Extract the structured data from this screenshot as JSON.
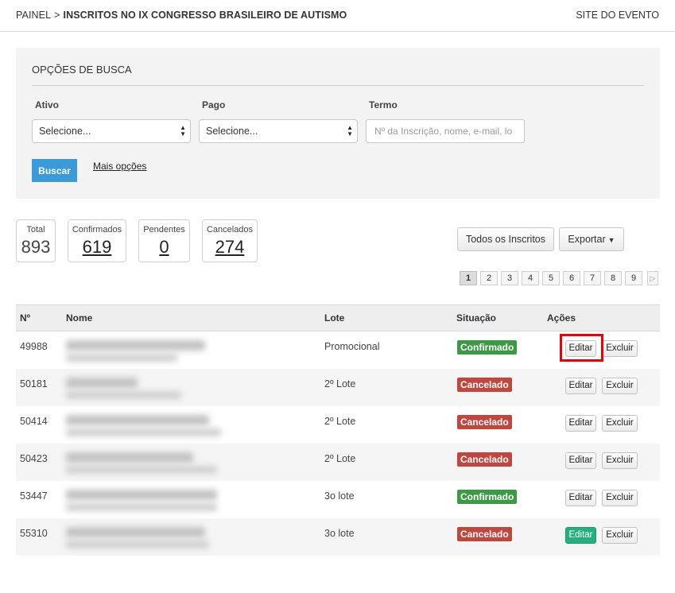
{
  "breadcrumb": {
    "root": "PAINEL",
    "separator": ">",
    "current": "INSCRITOS NO IX CONGRESSO BRASILEIRO DE AUTISMO"
  },
  "site_link": "SITE DO EVENTO",
  "search": {
    "title": "OPÇÕES DE BUSCA",
    "ativo_label": "Ativo",
    "ativo_value": "Selecione...",
    "pago_label": "Pago",
    "pago_value": "Selecione...",
    "termo_label": "Termo",
    "termo_placeholder": "Nº da Inscrição, nome, e-mail, lo",
    "buscar_label": "Buscar",
    "mais_opcoes": "Mais opções"
  },
  "stats": {
    "total_label": "Total",
    "total_value": "893",
    "confirmados_label": "Confirmados",
    "confirmados_value": "619",
    "pendentes_label": "Pendentes",
    "pendentes_value": "0",
    "cancelados_label": "Cancelados",
    "cancelados_value": "274"
  },
  "actions": {
    "todos": "Todos os Inscritos",
    "exportar": "Exportar"
  },
  "pagination": {
    "pages": [
      "1",
      "2",
      "3",
      "4",
      "5",
      "6",
      "7",
      "8",
      "9"
    ],
    "current": "1"
  },
  "table": {
    "headers": {
      "num": "Nº",
      "nome": "Nome",
      "lote": "Lote",
      "situacao": "Situação",
      "acoes": "Ações"
    },
    "edit_label": "Editar",
    "delete_label": "Excluir",
    "rows": [
      {
        "num": "49988",
        "lote": "Promocional",
        "situacao": "Confirmado",
        "status_color": "#3c9a47"
      },
      {
        "num": "50181",
        "lote": "2º Lote",
        "situacao": "Cancelado",
        "status_color": "#c0463e"
      },
      {
        "num": "50414",
        "lote": "2º Lote",
        "situacao": "Cancelado",
        "status_color": "#c0463e"
      },
      {
        "num": "50423",
        "lote": "2º Lote",
        "situacao": "Cancelado",
        "status_color": "#c0463e"
      },
      {
        "num": "53447",
        "lote": "3o lote",
        "situacao": "Confirmado",
        "status_color": "#3c9a47"
      },
      {
        "num": "55310",
        "lote": "3o lote",
        "situacao": "Cancelado",
        "status_color": "#c0463e"
      }
    ]
  },
  "colors": {
    "primary": "#3a9ad9",
    "success": "#3c9a47",
    "danger": "#c0463e",
    "edit_hover": "#24b07e",
    "highlight": "#e8000b"
  }
}
